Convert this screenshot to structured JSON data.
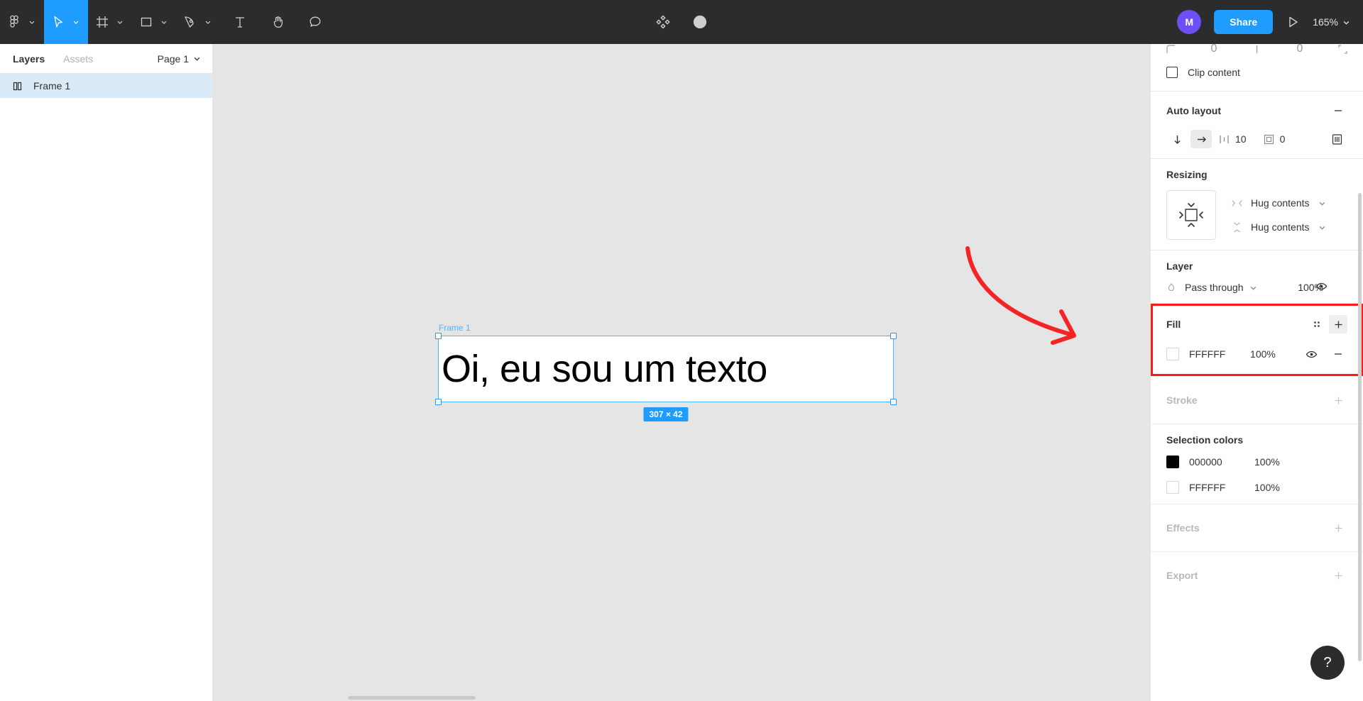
{
  "toolbar": {
    "tools": [
      {
        "name": "figma-menu-icon",
        "label": "Figma menu",
        "caret": true,
        "active": false
      },
      {
        "name": "move-tool-icon",
        "label": "Move",
        "caret": true,
        "active": true
      },
      {
        "name": "frame-tool-icon",
        "label": "Frame",
        "caret": true,
        "active": false
      },
      {
        "name": "shape-tool-icon",
        "label": "Rectangle",
        "caret": true,
        "active": false
      },
      {
        "name": "pen-tool-icon",
        "label": "Pen",
        "caret": true,
        "active": false
      },
      {
        "name": "text-tool-icon",
        "label": "Text",
        "caret": false,
        "active": false
      },
      {
        "name": "hand-tool-icon",
        "label": "Hand",
        "caret": false,
        "active": false
      },
      {
        "name": "comment-tool-icon",
        "label": "Comment",
        "caret": false,
        "active": false
      }
    ],
    "center": [
      {
        "name": "components-icon",
        "label": "Components"
      },
      {
        "name": "contrast-icon",
        "label": "Mask"
      }
    ],
    "avatar_initial": "M",
    "avatar_color": "#6c4ff6",
    "share_label": "Share",
    "present_label": "Present",
    "zoom_level": "165%"
  },
  "left_panel": {
    "tabs": [
      {
        "label": "Layers",
        "active": true
      },
      {
        "label": "Assets",
        "active": false
      }
    ],
    "page_name": "Page 1",
    "layers": [
      {
        "name": "Frame 1",
        "icon": "frame-autolayout-icon",
        "selected": true
      }
    ]
  },
  "canvas": {
    "frame_label": "Frame 1",
    "text_content": "Oi, eu sou um texto",
    "size_badge": "307 × 42",
    "selection_color": "#1e9cff",
    "background": "#e5e5e5",
    "annotation": "red-arrow-pointing-to-fill"
  },
  "right_panel": {
    "clip_content": {
      "label": "Clip content",
      "checked": false
    },
    "auto_layout": {
      "title": "Auto layout",
      "remove_label": "−",
      "direction_vertical": "vertical",
      "direction_horizontal": "horizontal",
      "active_direction": "horizontal",
      "spacing_value": "10",
      "padding_value": "0",
      "align_label": "alignment"
    },
    "resizing": {
      "title": "Resizing",
      "horizontal": "Hug contents",
      "vertical": "Hug contents"
    },
    "layer": {
      "title": "Layer",
      "blend_mode": "Pass through",
      "opacity": "100%"
    },
    "fill": {
      "title": "Fill",
      "highlighted": true,
      "styles_label": "styles",
      "add_label": "+",
      "items": [
        {
          "hex": "FFFFFF",
          "opacity": "100%",
          "color": "#ffffff"
        }
      ]
    },
    "stroke": {
      "title": "Stroke",
      "add_label": "+"
    },
    "selection_colors": {
      "title": "Selection colors",
      "items": [
        {
          "hex": "000000",
          "opacity": "100%",
          "color": "#000000"
        },
        {
          "hex": "FFFFFF",
          "opacity": "100%",
          "color": "#ffffff"
        }
      ]
    },
    "effects": {
      "title": "Effects",
      "add_label": "+"
    },
    "export": {
      "title": "Export",
      "add_label": "+"
    },
    "help_label": "?"
  }
}
